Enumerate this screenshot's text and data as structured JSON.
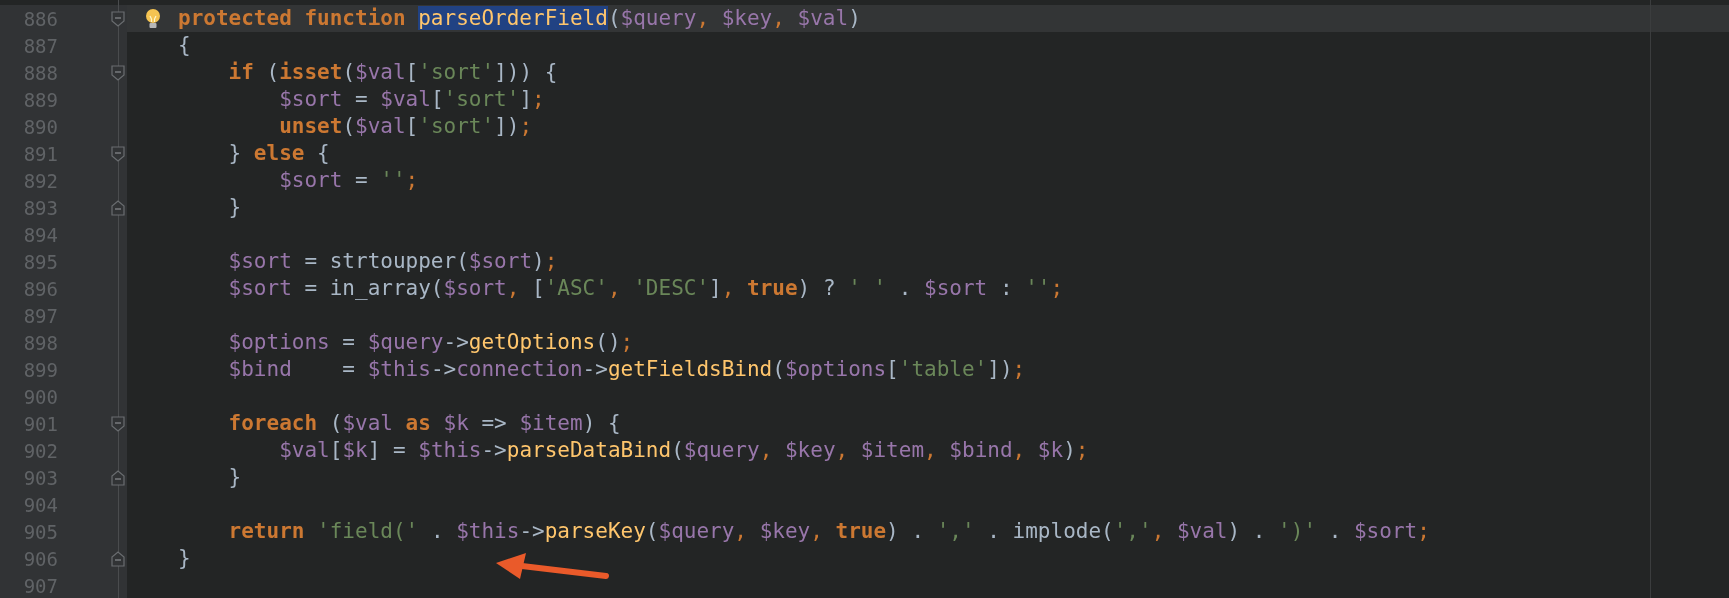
{
  "editor": {
    "lines": [
      {
        "number": "886",
        "kind": "fold-start",
        "current": true,
        "hint": true,
        "tokens": [
          {
            "kind": "keyword",
            "text": "protected function "
          },
          {
            "kind": "selected-function",
            "text": "parseOrderField"
          },
          {
            "kind": "plain",
            "text": "("
          },
          {
            "kind": "variable",
            "text": "$query"
          },
          {
            "kind": "punct",
            "text": ", "
          },
          {
            "kind": "variable",
            "text": "$key"
          },
          {
            "kind": "punct",
            "text": ", "
          },
          {
            "kind": "variable",
            "text": "$val"
          },
          {
            "kind": "plain",
            "text": ")"
          }
        ]
      },
      {
        "number": "887",
        "kind": "plain",
        "current": false,
        "tokens": [
          {
            "kind": "plain",
            "text": "{"
          }
        ]
      },
      {
        "number": "888",
        "kind": "fold-start",
        "current": false,
        "tokens": [
          {
            "kind": "keyword",
            "text": "    if"
          },
          {
            "kind": "plain",
            "text": " ("
          },
          {
            "kind": "keyword",
            "text": "isset"
          },
          {
            "kind": "plain",
            "text": "("
          },
          {
            "kind": "variable",
            "text": "$val"
          },
          {
            "kind": "plain",
            "text": "["
          },
          {
            "kind": "string",
            "text": "'sort'"
          },
          {
            "kind": "plain",
            "text": "])) {"
          }
        ]
      },
      {
        "number": "889",
        "kind": "plain",
        "current": false,
        "tokens": [
          {
            "kind": "variable",
            "text": "        $sort"
          },
          {
            "kind": "plain",
            "text": " = "
          },
          {
            "kind": "variable",
            "text": "$val"
          },
          {
            "kind": "plain",
            "text": "["
          },
          {
            "kind": "string",
            "text": "'sort'"
          },
          {
            "kind": "plain",
            "text": "]"
          },
          {
            "kind": "punct",
            "text": ";"
          }
        ]
      },
      {
        "number": "890",
        "kind": "plain",
        "current": false,
        "tokens": [
          {
            "kind": "keyword",
            "text": "        unset"
          },
          {
            "kind": "plain",
            "text": "("
          },
          {
            "kind": "variable",
            "text": "$val"
          },
          {
            "kind": "plain",
            "text": "["
          },
          {
            "kind": "string",
            "text": "'sort'"
          },
          {
            "kind": "plain",
            "text": "])"
          },
          {
            "kind": "punct",
            "text": ";"
          }
        ]
      },
      {
        "number": "891",
        "kind": "fold-start",
        "current": false,
        "tokens": [
          {
            "kind": "plain",
            "text": "    } "
          },
          {
            "kind": "keyword",
            "text": "else"
          },
          {
            "kind": "plain",
            "text": " {"
          }
        ]
      },
      {
        "number": "892",
        "kind": "plain",
        "current": false,
        "tokens": [
          {
            "kind": "variable",
            "text": "        $sort"
          },
          {
            "kind": "plain",
            "text": " = "
          },
          {
            "kind": "string",
            "text": "''"
          },
          {
            "kind": "punct",
            "text": ";"
          }
        ]
      },
      {
        "number": "893",
        "kind": "fold-end",
        "current": false,
        "tokens": [
          {
            "kind": "plain",
            "text": "    }"
          }
        ]
      },
      {
        "number": "894",
        "kind": "plain",
        "current": false
      },
      {
        "number": "895",
        "kind": "plain",
        "current": false,
        "tokens": [
          {
            "kind": "variable",
            "text": "    $sort"
          },
          {
            "kind": "plain",
            "text": " = strtoupper("
          },
          {
            "kind": "variable",
            "text": "$sort"
          },
          {
            "kind": "plain",
            "text": ")"
          },
          {
            "kind": "punct",
            "text": ";"
          }
        ]
      },
      {
        "number": "896",
        "kind": "plain",
        "current": false,
        "tokens": [
          {
            "kind": "variable",
            "text": "    $sort"
          },
          {
            "kind": "plain",
            "text": " = in_array("
          },
          {
            "kind": "variable",
            "text": "$sort"
          },
          {
            "kind": "punct",
            "text": ", "
          },
          {
            "kind": "plain",
            "text": "["
          },
          {
            "kind": "string",
            "text": "'ASC'"
          },
          {
            "kind": "punct",
            "text": ", "
          },
          {
            "kind": "string",
            "text": "'DESC'"
          },
          {
            "kind": "plain",
            "text": "]"
          },
          {
            "kind": "punct",
            "text": ", "
          },
          {
            "kind": "keyword",
            "text": "true"
          },
          {
            "kind": "plain",
            "text": ") ? "
          },
          {
            "kind": "string",
            "text": "' '"
          },
          {
            "kind": "plain",
            "text": " . "
          },
          {
            "kind": "variable",
            "text": "$sort"
          },
          {
            "kind": "plain",
            "text": " : "
          },
          {
            "kind": "string",
            "text": "''"
          },
          {
            "kind": "punct",
            "text": ";"
          }
        ]
      },
      {
        "number": "897",
        "kind": "plain",
        "current": false
      },
      {
        "number": "898",
        "kind": "plain",
        "current": false,
        "tokens": [
          {
            "kind": "variable",
            "text": "    $options"
          },
          {
            "kind": "plain",
            "text": " = "
          },
          {
            "kind": "variable",
            "text": "$query"
          },
          {
            "kind": "plain",
            "text": "->"
          },
          {
            "kind": "function",
            "text": "getOptions"
          },
          {
            "kind": "plain",
            "text": "()"
          },
          {
            "kind": "punct",
            "text": ";"
          }
        ]
      },
      {
        "number": "899",
        "kind": "plain",
        "current": false,
        "tokens": [
          {
            "kind": "variable",
            "text": "    $bind"
          },
          {
            "kind": "plain",
            "text": "    = "
          },
          {
            "kind": "variable",
            "text": "$this"
          },
          {
            "kind": "plain",
            "text": "->"
          },
          {
            "kind": "variable",
            "text": "connection"
          },
          {
            "kind": "plain",
            "text": "->"
          },
          {
            "kind": "function",
            "text": "getFieldsBind"
          },
          {
            "kind": "plain",
            "text": "("
          },
          {
            "kind": "variable",
            "text": "$options"
          },
          {
            "kind": "plain",
            "text": "["
          },
          {
            "kind": "string",
            "text": "'table'"
          },
          {
            "kind": "plain",
            "text": "])"
          },
          {
            "kind": "punct",
            "text": ";"
          }
        ]
      },
      {
        "number": "900",
        "kind": "plain",
        "current": false
      },
      {
        "number": "901",
        "kind": "fold-start",
        "current": false,
        "tokens": [
          {
            "kind": "keyword",
            "text": "    foreach"
          },
          {
            "kind": "plain",
            "text": " ("
          },
          {
            "kind": "variable",
            "text": "$val"
          },
          {
            "kind": "keyword",
            "text": " as "
          },
          {
            "kind": "variable",
            "text": "$k"
          },
          {
            "kind": "plain",
            "text": " => "
          },
          {
            "kind": "variable",
            "text": "$item"
          },
          {
            "kind": "plain",
            "text": ") {"
          }
        ]
      },
      {
        "number": "902",
        "kind": "plain",
        "current": false,
        "tokens": [
          {
            "kind": "variable",
            "text": "        $val"
          },
          {
            "kind": "plain",
            "text": "["
          },
          {
            "kind": "variable",
            "text": "$k"
          },
          {
            "kind": "plain",
            "text": "] = "
          },
          {
            "kind": "variable",
            "text": "$this"
          },
          {
            "kind": "plain",
            "text": "->"
          },
          {
            "kind": "function",
            "text": "parseDataBind"
          },
          {
            "kind": "plain",
            "text": "("
          },
          {
            "kind": "variable",
            "text": "$query"
          },
          {
            "kind": "punct",
            "text": ", "
          },
          {
            "kind": "variable",
            "text": "$key"
          },
          {
            "kind": "punct",
            "text": ", "
          },
          {
            "kind": "variable",
            "text": "$item"
          },
          {
            "kind": "punct",
            "text": ", "
          },
          {
            "kind": "variable",
            "text": "$bind"
          },
          {
            "kind": "punct",
            "text": ", "
          },
          {
            "kind": "variable",
            "text": "$k"
          },
          {
            "kind": "plain",
            "text": ")"
          },
          {
            "kind": "punct",
            "text": ";"
          }
        ]
      },
      {
        "number": "903",
        "kind": "fold-end",
        "current": false,
        "tokens": [
          {
            "kind": "plain",
            "text": "    }"
          }
        ]
      },
      {
        "number": "904",
        "kind": "plain",
        "current": false
      },
      {
        "number": "905",
        "kind": "plain",
        "current": false,
        "tokens": [
          {
            "kind": "keyword",
            "text": "    return "
          },
          {
            "kind": "string",
            "text": "'field('"
          },
          {
            "kind": "plain",
            "text": " . "
          },
          {
            "kind": "variable",
            "text": "$this"
          },
          {
            "kind": "plain",
            "text": "->"
          },
          {
            "kind": "function",
            "text": "parseKey"
          },
          {
            "kind": "plain",
            "text": "("
          },
          {
            "kind": "variable",
            "text": "$query"
          },
          {
            "kind": "punct",
            "text": ", "
          },
          {
            "kind": "variable",
            "text": "$key"
          },
          {
            "kind": "punct",
            "text": ", "
          },
          {
            "kind": "keyword",
            "text": "true"
          },
          {
            "kind": "plain",
            "text": ") . "
          },
          {
            "kind": "string",
            "text": "','"
          },
          {
            "kind": "plain",
            "text": " . implode("
          },
          {
            "kind": "string",
            "text": "','"
          },
          {
            "kind": "punct",
            "text": ", "
          },
          {
            "kind": "variable",
            "text": "$val"
          },
          {
            "kind": "plain",
            "text": ") . "
          },
          {
            "kind": "string",
            "text": "')'"
          },
          {
            "kind": "plain",
            "text": " . "
          },
          {
            "kind": "variable",
            "text": "$sort"
          },
          {
            "kind": "punct",
            "text": ";"
          }
        ]
      },
      {
        "number": "906",
        "kind": "fold-end",
        "current": false,
        "tokens": [
          {
            "kind": "plain",
            "text": "}"
          }
        ]
      },
      {
        "number": "907",
        "kind": "plain",
        "current": false
      }
    ]
  }
}
